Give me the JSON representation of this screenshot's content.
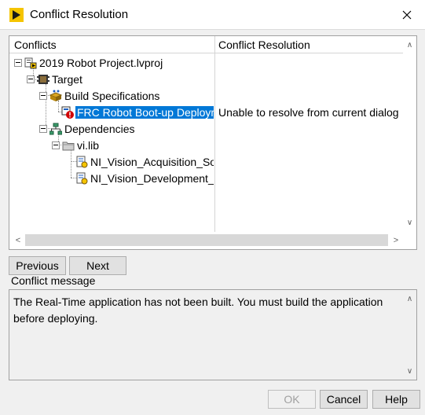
{
  "window": {
    "title": "Conflict Resolution",
    "close_glyph": "✕"
  },
  "table": {
    "headers": [
      "Conflicts",
      "Conflict Resolution"
    ],
    "rows": [
      {
        "label": "2019 Robot Project.lvproj",
        "icon": "lvproj-icon"
      },
      {
        "label": "Target",
        "icon": "target-icon"
      },
      {
        "label": "Build Specifications",
        "icon": "build-specifications-icon"
      },
      {
        "label": "FRC Robot Boot-up Deployment",
        "icon": "build-spec-error-icon",
        "resolution": "Unable to resolve from current dialog"
      },
      {
        "label": "Dependencies",
        "icon": "dependencies-icon"
      },
      {
        "label": "vi.lib",
        "icon": "folder-icon"
      },
      {
        "label": "NI_Vision_Acquisition_Software.lvlib",
        "icon": "library-icon"
      },
      {
        "label": "NI_Vision_Development_Module.lvlib",
        "icon": "library-icon"
      }
    ]
  },
  "scrollbars": {
    "up": "∧",
    "down": "∨",
    "left": "<",
    "right": ">"
  },
  "nav": {
    "previous": "Previous",
    "next": "Next"
  },
  "message": {
    "label": "Conflict message",
    "text": "The Real-Time application has not been built.  You must build the application before deploying."
  },
  "buttons": {
    "ok": "OK",
    "cancel": "Cancel",
    "help": "Help",
    "ok_enabled": false
  },
  "colors": {
    "selection": "#0078d7",
    "dialog_bg": "#f0f0f0",
    "error": "#d10000"
  }
}
